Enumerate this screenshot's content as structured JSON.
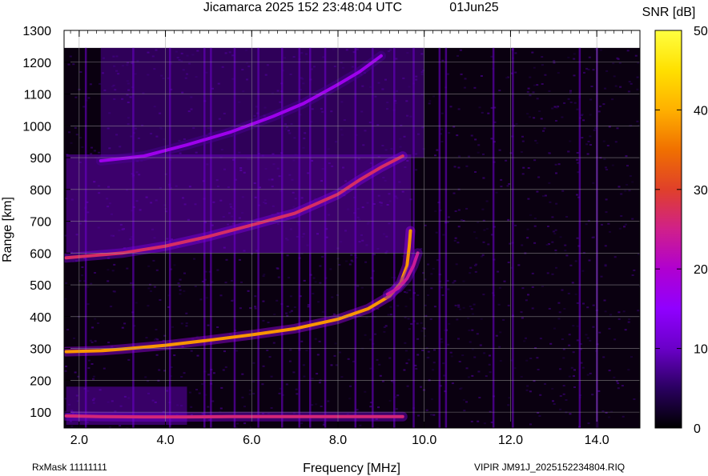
{
  "header": {
    "title": "Jicamarca 2025 152 23:48:04 UTC",
    "date": "01Jun25"
  },
  "footer": {
    "rxmask": "RxMask 11111111",
    "file": "VIPIR  JM91J_2025152234804.RIQ"
  },
  "chart_data": {
    "type": "heatmap",
    "title": "Jicamarca 2025 152 23:48:04 UTC",
    "xlabel": "Frequency [MHz]",
    "ylabel": "Range [km]",
    "xlim": [
      1.65,
      15.0
    ],
    "ylim": [
      50,
      1300
    ],
    "x_ticks": [
      2.0,
      4.0,
      6.0,
      8.0,
      10.0,
      12.0,
      14.0
    ],
    "x_tick_labels": [
      "2.0",
      "4.0",
      "6.0",
      "8.0",
      "10.0",
      "12.0",
      "14.0"
    ],
    "y_ticks": [
      100,
      200,
      300,
      400,
      500,
      600,
      700,
      800,
      900,
      1000,
      1100,
      1200,
      1300
    ],
    "y_tick_labels": [
      "100",
      "200",
      "300",
      "400",
      "500",
      "600",
      "700",
      "800",
      "900",
      "1000",
      "1100",
      "1200",
      "1300"
    ],
    "data_range_max_km": 1245,
    "grid": true,
    "colorbar": {
      "label": "SNR [dB]",
      "min": 0,
      "max": 50,
      "ticks": [
        0,
        10,
        20,
        30,
        40,
        50
      ],
      "tick_labels": [
        "0",
        "10",
        "20",
        "30",
        "40",
        "50"
      ],
      "colors": [
        "#000000",
        "#2a0060",
        "#6a00c8",
        "#9000ff",
        "#b000d0",
        "#d0208a",
        "#e0402a",
        "#f07000",
        "#ffb000",
        "#ffe000",
        "#ffff40"
      ]
    },
    "echoes": [
      {
        "name": "F-layer 1st hop",
        "snr_db": 38,
        "points": [
          [
            1.7,
            290
          ],
          [
            2.5,
            293
          ],
          [
            3.0,
            298
          ],
          [
            4.0,
            310
          ],
          [
            5.0,
            326
          ],
          [
            6.0,
            343
          ],
          [
            7.0,
            362
          ],
          [
            8.0,
            392
          ],
          [
            8.7,
            425
          ],
          [
            9.2,
            465
          ],
          [
            9.45,
            505
          ],
          [
            9.6,
            560
          ],
          [
            9.65,
            620
          ],
          [
            9.68,
            670
          ]
        ]
      },
      {
        "name": "F-layer X-mode trace",
        "snr_db": 24,
        "points": [
          [
            9.15,
            470
          ],
          [
            9.4,
            490
          ],
          [
            9.6,
            520
          ],
          [
            9.75,
            560
          ],
          [
            9.85,
            600
          ]
        ]
      },
      {
        "name": "F-layer 2nd hop",
        "snr_db": 27,
        "points": [
          [
            1.7,
            585
          ],
          [
            3.0,
            600
          ],
          [
            4.0,
            622
          ],
          [
            5.0,
            652
          ],
          [
            6.0,
            688
          ],
          [
            7.0,
            725
          ],
          [
            8.0,
            785
          ],
          [
            8.5,
            830
          ],
          [
            9.0,
            870
          ],
          [
            9.5,
            905
          ]
        ]
      },
      {
        "name": "F-layer 3rd hop",
        "snr_db": 17,
        "points": [
          [
            2.5,
            890
          ],
          [
            3.5,
            905
          ],
          [
            4.5,
            940
          ],
          [
            5.5,
            980
          ],
          [
            6.5,
            1030
          ],
          [
            7.2,
            1070
          ],
          [
            8.0,
            1130
          ],
          [
            8.5,
            1170
          ],
          [
            9.0,
            1220
          ]
        ]
      },
      {
        "name": "E-layer echo",
        "snr_db": 26,
        "points": [
          [
            1.7,
            88
          ],
          [
            2.5,
            86
          ],
          [
            3.5,
            85
          ],
          [
            4.5,
            85
          ],
          [
            5.5,
            86
          ],
          [
            6.5,
            86
          ],
          [
            7.5,
            86
          ],
          [
            8.5,
            86
          ],
          [
            9.5,
            86
          ]
        ]
      }
    ],
    "diffuse_regions": [
      {
        "name": "spread F near 2nd hop",
        "f": [
          1.7,
          9.7
        ],
        "range": [
          600,
          910
        ],
        "snr_db": 12
      },
      {
        "name": "spread F above 3rd hop",
        "f": [
          2.5,
          10.0
        ],
        "range": [
          900,
          1245
        ],
        "snr_db": 9
      },
      {
        "name": "low-range clutter",
        "f": [
          1.7,
          4.5
        ],
        "range": [
          60,
          180
        ],
        "snr_db": 11
      }
    ],
    "interference_columns_mhz": [
      2.15,
      3.25,
      4.1,
      4.9,
      5.05,
      5.6,
      6.15,
      6.7,
      7.1,
      7.35,
      7.7,
      8.4,
      8.8,
      9.3,
      9.75,
      10.35,
      10.5,
      11.6,
      12.05,
      13.6,
      14.0
    ]
  }
}
